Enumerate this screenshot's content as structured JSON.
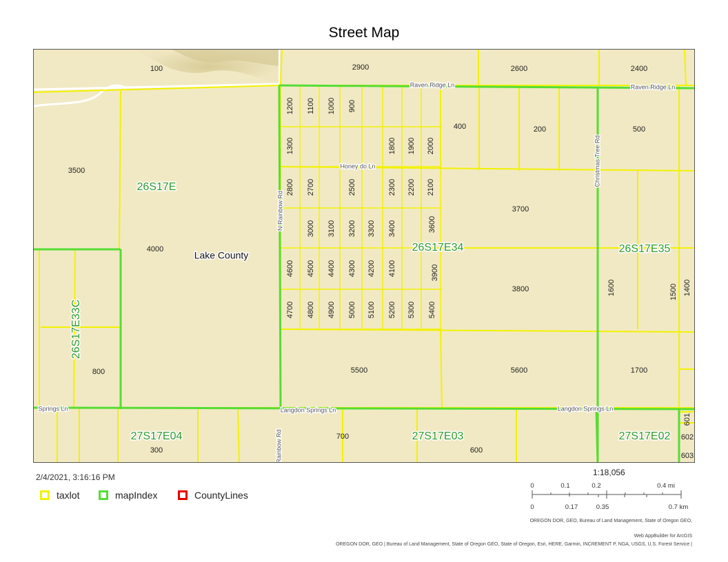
{
  "title": "Street Map",
  "timestamp": "2/4/2021, 3:16:16 PM",
  "legend": [
    {
      "label": "taxlot",
      "color": "#f2f200"
    },
    {
      "label": "mapIndex",
      "color": "#55dd33"
    },
    {
      "label": "CountyLines",
      "color": "#e60000"
    }
  ],
  "scale": {
    "ratio": "1:18,056",
    "mi_ticks": [
      "0",
      "0.1",
      "0.2",
      "0.4 mi"
    ],
    "km_ticks": [
      "0",
      "0.17",
      "0.35",
      "0.7 km"
    ]
  },
  "attribution": {
    "line1": "OREGON DOR, GEO, Bureau of Land Management, State of Oregon GEO,",
    "line2": "Web AppBuilder for ArcGIS",
    "line3": "OREGON DOR, GEO | Bureau of Land Management, State of Oregon GEO, State of Oregon, Esri, HERE, Garmin, INCREMENT P, NGA, USGS, U.S. Forest Service |"
  },
  "map": {
    "county_label": "Lake County",
    "section_labels": [
      "26S17E",
      "26S17E34",
      "26S17E35",
      "26S17E33C",
      "27S17E04",
      "27S17E03",
      "27S17E02"
    ],
    "road_labels": [
      "Raven Ridge Ln",
      "Raven Ridge Ln",
      "Honey do Ln",
      "N Rainbow Rd",
      "Christmas Tree Rd",
      "Langdon Springs Ln",
      "Langdon Springs Ln",
      "Springs Ln",
      "Rainbow Rd"
    ],
    "taxlot_labels": [
      "100",
      "2900",
      "2600",
      "2400",
      "3500",
      "4000",
      "400",
      "200",
      "500",
      "3700",
      "3800",
      "1600",
      "1500",
      "1400",
      "800",
      "5500",
      "5600",
      "1700",
      "700",
      "600",
      "300",
      "601",
      "602",
      "603",
      "1200",
      "1100",
      "1000",
      "900",
      "1300",
      "1800",
      "1900",
      "2000",
      "2800",
      "2700",
      "2500",
      "2300",
      "2200",
      "2100",
      "3000",
      "3100",
      "3200",
      "3300",
      "3400",
      "3600",
      "4600",
      "4500",
      "4400",
      "4300",
      "4200",
      "4100",
      "3900",
      "4700",
      "4800",
      "4900",
      "5000",
      "5100",
      "5200",
      "5300",
      "5400"
    ]
  }
}
